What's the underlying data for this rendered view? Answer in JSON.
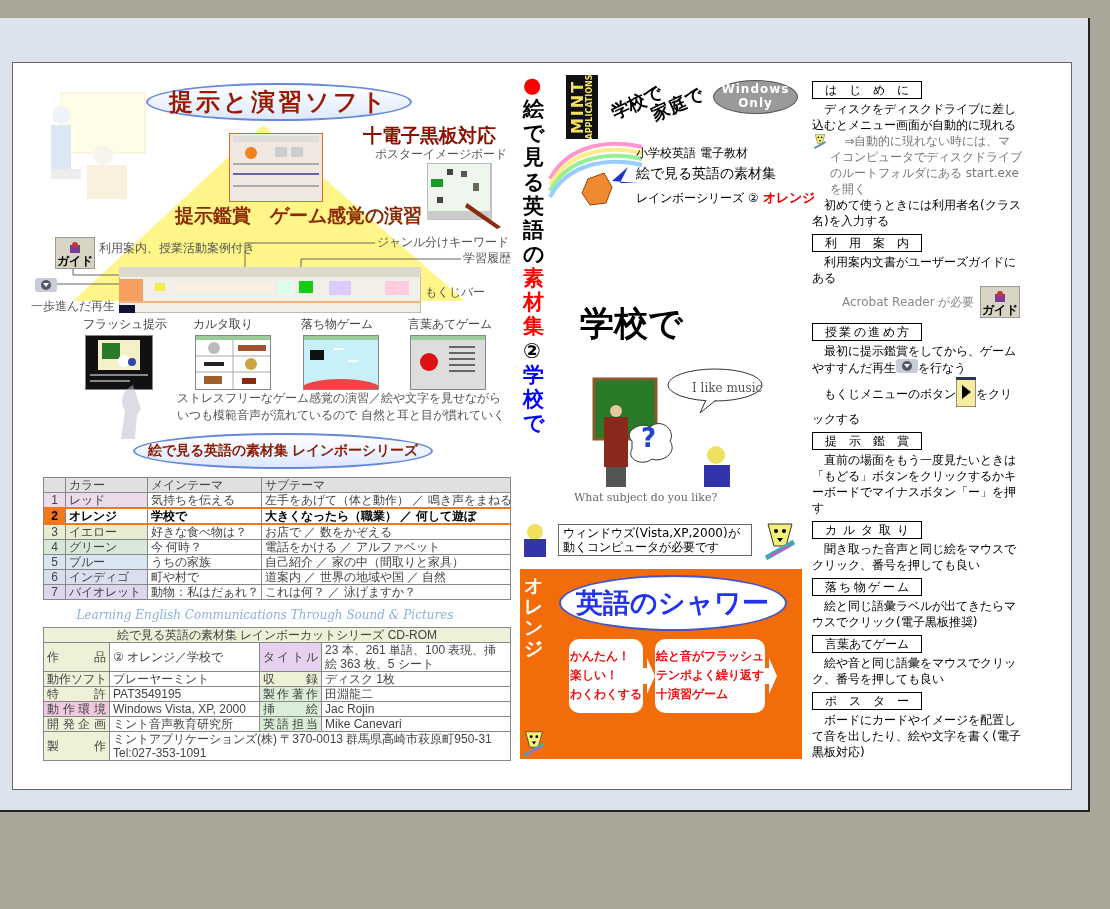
{
  "diagram": {
    "title": "提示と演習ソフト",
    "badge": "十電子黒板対応",
    "poster_label": "ポスターイメージボード",
    "heading": "提示鑑賞　ゲーム感覚の演習",
    "guide_icon_label": "ガイド",
    "callouts": [
      {
        "kind": "guide",
        "text": "利用案内、授業活動案例付き"
      },
      {
        "kind": "genre",
        "text": "ジャンル分けキーワード"
      },
      {
        "kind": "history",
        "text": "学習履歴"
      },
      {
        "kind": "toc",
        "text": "もくじバー"
      },
      {
        "kind": "replay",
        "text": "一歩進んだ再生"
      }
    ],
    "games": [
      {
        "kind": "flash",
        "label": "フラッシュ提示"
      },
      {
        "kind": "karuta",
        "label": "カルタ取り"
      },
      {
        "kind": "falling",
        "label": "落ち物ゲーム"
      },
      {
        "kind": "quiz",
        "label": "言葉あてゲーム"
      }
    ],
    "description": [
      "ストレスフリーなゲーム感覚の演習／絵や文字を見せながら",
      "いつも模範音声が流れているので 自然と耳と目が慣れていく"
    ],
    "series_title": "絵で見る英語の素材集 レインボーシリーズ"
  },
  "color_table": {
    "columns": [
      "カラー",
      "メインテーマ",
      "サブテーマ"
    ],
    "rows": [
      {
        "num": "1",
        "color_name": "レッド",
        "main": "気持ちを伝える",
        "sub": "左手をあげて（体と動作） ／ 鳴き声をまねる",
        "color": "#ecd9ea",
        "selected": false
      },
      {
        "num": "2",
        "color_name": "オレンジ",
        "main": "学校で",
        "sub": "大きくなったら（職業） ／ 何して遊ぼ",
        "color": "#f07818",
        "selected": true
      },
      {
        "num": "3",
        "color_name": "イエロー",
        "main": "好きな食べ物は？",
        "sub": "お店で ／ 数をかぞえる",
        "color": "#e8ecd0",
        "selected": false
      },
      {
        "num": "4",
        "color_name": "グリーン",
        "main": "今 何時？",
        "sub": "電話をかける ／ アルファベット",
        "color": "#d8e8d8",
        "selected": false
      },
      {
        "num": "5",
        "color_name": "ブルー",
        "main": "うちの家族",
        "sub": "自己紹介 ／ 家の中（間取りと家具）",
        "color": "#d8e6f2",
        "selected": false
      },
      {
        "num": "6",
        "color_name": "インディゴ",
        "main": "町や村で",
        "sub": "道案内 ／ 世界の地域や国 ／ 自然",
        "color": "#d8e0f0",
        "selected": false
      },
      {
        "num": "7",
        "color_name": "バイオレット",
        "main": "動物：私はだぁれ？",
        "sub": "これは何？ ／ 泳げますか？",
        "color": "#ddd6ee",
        "selected": false
      }
    ]
  },
  "tagline": "Learning English Communications Through Sound & Pictures",
  "info_table": {
    "title": "絵で見る英語の素材集 レインボーカットシリーズ CD-ROM",
    "rows": [
      {
        "cells": [
          {
            "label": "作品",
            "color": "#eef0d8",
            "value": "② オレンジ／学校で"
          },
          {
            "label": "タイトル",
            "color": "#e6d2ee",
            "value": "23 本、261 単語、100 表現、挿絵 363 枚、5 シート"
          }
        ]
      },
      {
        "cells": [
          {
            "label": "動作ソフト",
            "color": "#eef0d8",
            "value": "プレーヤーミント"
          },
          {
            "label": "収録",
            "color": "#eef0d8",
            "value": "ディスク 1枚"
          }
        ]
      },
      {
        "cells": [
          {
            "label": "特許",
            "color": "#eef0d8",
            "value": "PAT3549195"
          },
          {
            "label": "製作著作",
            "color": "#d8eed8",
            "value": "田淵龍二"
          }
        ]
      },
      {
        "cells": [
          {
            "label": "動作環境",
            "color": "#f0c8e0",
            "value": "Windows Vista, XP, 2000"
          },
          {
            "label": "挿絵",
            "color": "#d8eed8",
            "value": "Jac Rojin"
          }
        ]
      },
      {
        "cells": [
          {
            "label": "開発企画",
            "color": "#eef0d8",
            "value": "ミント音声教育研究所"
          },
          {
            "label": "英語担当",
            "color": "#d8eed8",
            "value": "Mike Canevari"
          }
        ]
      },
      {
        "cells": [
          {
            "label": "製作",
            "color": "#eef0d8",
            "value": "ミントアプリケーションズ(株) 〒370-0013 群馬県高崎市萩原町950-31 Tel:027-353-1091"
          }
        ]
      }
    ]
  },
  "cover": {
    "spine": [
      {
        "text": "●",
        "color": "#ff0000"
      },
      {
        "text": "絵で見る英語の",
        "color": "#000000"
      },
      {
        "text": "素材集",
        "color": "#ff0000"
      },
      {
        "text": "②",
        "color": "#000000"
      },
      {
        "text": "学校で",
        "color": "#0000ff"
      }
    ],
    "logo": [
      "MINT",
      "APPLICATIONS"
    ],
    "slogan": [
      "学校で",
      "家庭で"
    ],
    "platform": [
      "Windows",
      "Only"
    ],
    "kicker": "小学校英語 電子教材",
    "product": "絵で見る英語の素材集",
    "series": "レインボーシリーズ ②",
    "series_color": "オレンジ",
    "theme": "学校で",
    "question_mark": "?",
    "speech": "I like music",
    "caption": "What subject do you like?",
    "requirement": "ウィンドウズ(Vista,XP,2000)が動くコンピュータが必要です",
    "panel": {
      "side_label": "オレンジ",
      "banner": "英語のシャワー",
      "steps": [
        {
          "lines": [
            "かんたん！",
            "楽しい！",
            "わくわくする"
          ]
        },
        {
          "lines": [
            "絵と音がフラッシュ",
            "テンポよく繰り返す",
            "十演習ゲーム"
          ]
        }
      ]
    }
  },
  "guide": [
    {
      "heading": "はじめに",
      "paragraphs": [
        {
          "kind": "text",
          "text": "ディスクをディスクドライブに差し込むとメニュー画面が自動的に現れる"
        },
        {
          "kind": "note",
          "text": "⇒自動的に現れない時には、マイコンピュータでディスクドライブのルートフォルダにある start.exe を開く"
        },
        {
          "kind": "text",
          "text": "初めて使うときには利用者名(クラス名)を入力する"
        }
      ]
    },
    {
      "heading": "利用案内",
      "paragraphs": [
        {
          "kind": "text",
          "text": "利用案内文書がユーザーズガイドにある"
        },
        {
          "kind": "requirement",
          "text": "Acrobat Reader が必要",
          "icon_label": "ガイド"
        }
      ]
    },
    {
      "heading": "授業の進め方",
      "paragraphs": [
        {
          "kind": "with_replay_icon",
          "before": "最初に提示鑑賞をしてから、ゲームやすすんだ再生",
          "after": "を行なう"
        },
        {
          "kind": "with_play_icon",
          "before": "もくじメニューのボタン",
          "after": "をクリックする"
        }
      ]
    },
    {
      "heading": "提示鑑賞",
      "paragraphs": [
        {
          "kind": "text",
          "text": "直前の場面をもう一度見たいときは「もどる」ボタンをクリックするかキーボードでマイナスボタン「ー」を押す"
        }
      ]
    },
    {
      "heading": "カルタ取り",
      "paragraphs": [
        {
          "kind": "text",
          "text": "聞き取った音声と同じ絵をマウスでクリック、番号を押しても良い"
        }
      ]
    },
    {
      "heading": "落ち物ゲーム",
      "paragraphs": [
        {
          "kind": "text",
          "text": "絵と同じ語彙ラベルが出てきたらマウスでクリック(電子黒板推奨)"
        }
      ]
    },
    {
      "heading": "言葉あてゲーム",
      "paragraphs": [
        {
          "kind": "text",
          "text": "絵や音と同じ語彙をマウスでクリック、番号を押しても良い"
        }
      ]
    },
    {
      "heading": "ポスター",
      "paragraphs": [
        {
          "kind": "text",
          "text": "ボードにカードやイメージを配置して音を出したり、絵や文字を書く(電子黒板対応)"
        }
      ]
    }
  ]
}
